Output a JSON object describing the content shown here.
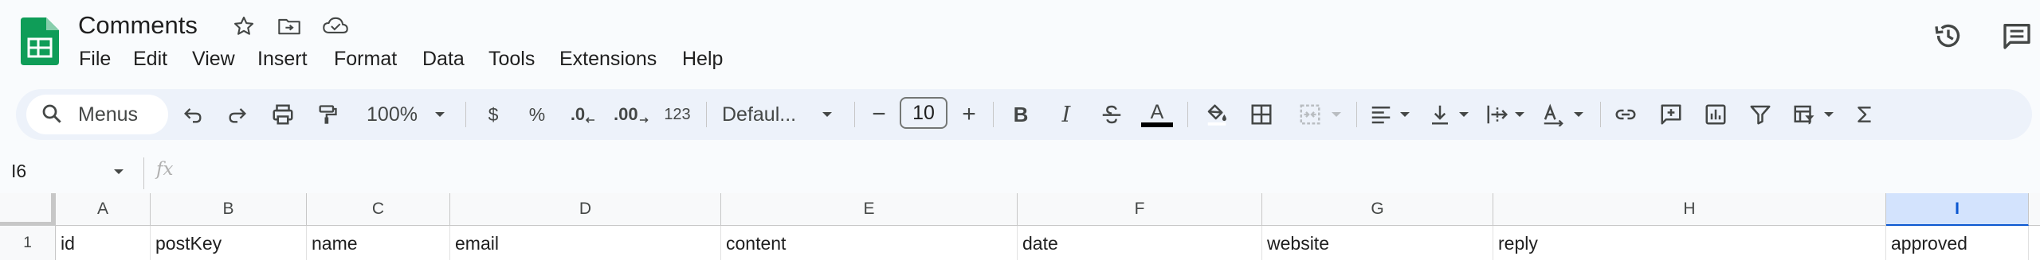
{
  "header": {
    "title": "Comments",
    "icons": [
      "star-icon",
      "move-to-folder-icon",
      "cloud-saved-icon"
    ]
  },
  "menu": [
    "File",
    "Edit",
    "View",
    "Insert",
    "Format",
    "Data",
    "Tools",
    "Extensions",
    "Help"
  ],
  "right_icons": [
    "version-history-icon",
    "comments-icon"
  ],
  "toolbar": {
    "search_placeholder": "Menus",
    "zoom": "100%",
    "currency": "$",
    "percent": "%",
    "decrease_decimal": ".0",
    "increase_decimal": ".00",
    "number_format": "123",
    "font": "Defaul...",
    "font_size": "10",
    "minus": "−",
    "plus": "+",
    "bold": "B",
    "italic": "I",
    "text_color_letter": "A",
    "text_color": "#000000"
  },
  "formula_bar": {
    "name_box": "I6",
    "fx": "fx"
  },
  "grid": {
    "columns": [
      "A",
      "B",
      "C",
      "D",
      "E",
      "F",
      "G",
      "H",
      "I"
    ],
    "selected_column": "I",
    "row_number": "1",
    "row1": [
      "id",
      "postKey",
      "name",
      "email",
      "content",
      "date",
      "website",
      "reply",
      "approved"
    ]
  },
  "colors": {
    "accent": "#0b57d0",
    "sheets_green": "#0f9d58",
    "toolbar_bg": "#edf2fa"
  }
}
